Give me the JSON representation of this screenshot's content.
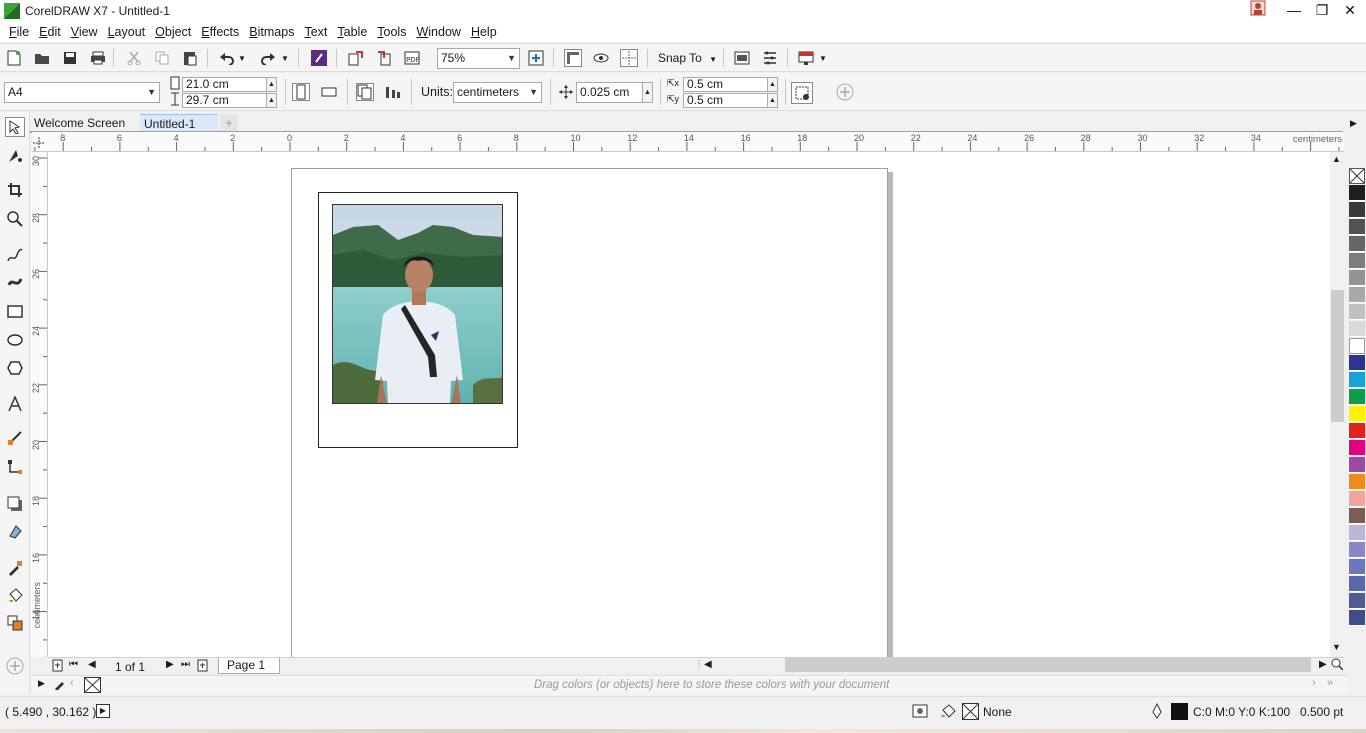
{
  "window": {
    "title": "CorelDRAW X7 - Untitled-1",
    "minimize": "—",
    "restore": "❐",
    "close": "✕"
  },
  "menu": [
    "File",
    "Edit",
    "View",
    "Layout",
    "Object",
    "Effects",
    "Bitmaps",
    "Text",
    "Table",
    "Tools",
    "Window",
    "Help"
  ],
  "toolbar": {
    "zoom_level": "75%",
    "snap_to_label": "Snap To"
  },
  "property_bar": {
    "page_size": "A4",
    "page_width": "21.0 cm",
    "page_height": "29.7 cm",
    "units_label": "Units:",
    "units_value": "centimeters",
    "nudge": "0.025 cm",
    "duplicate_x": "0.5 cm",
    "duplicate_y": "0.5 cm"
  },
  "tabs": [
    {
      "label": "Welcome Screen"
    },
    {
      "label": "Untitled-1",
      "active": true
    }
  ],
  "ruler": {
    "horizontal_ticks": [
      "8",
      "6",
      "4",
      "2",
      "0",
      "2",
      "4",
      "6",
      "8",
      "10",
      "12",
      "14",
      "16",
      "18",
      "20",
      "22",
      "24",
      "26",
      "28",
      "30",
      "32",
      "34"
    ],
    "unit_label": "centimeters",
    "vertical_ticks": [
      "30",
      "28",
      "26",
      "24",
      "22",
      "20",
      "18",
      "16",
      "14"
    ],
    "vertical_unit_label": "centimeters"
  },
  "page_nav": {
    "page_count": "1 of 1",
    "page_tab": "Page 1"
  },
  "doc_palette": {
    "hint": "Drag colors (or objects) here to store these colors with your document"
  },
  "status": {
    "coordinates": "( 5.490 , 30.162 )",
    "fill_label": "None",
    "outline_color": "C:0 M:0 Y:0 K:100",
    "outline_width": "0.500 pt"
  },
  "palette_colors": [
    "#1e1e1e",
    "#3a3a3a",
    "#525252",
    "#676767",
    "#7d7d7d",
    "#939393",
    "#a9a9a9",
    "#c0c0c0",
    "#d9d9d9",
    "#ffffff",
    "#2b3590",
    "#1aa0dc",
    "#0a9e4a",
    "#fff200",
    "#e32119",
    "#e4007c",
    "#9b4aa0",
    "#f08a1c",
    "#f6a39a",
    "#7a5f50",
    "#bab7dd",
    "#8b86c4",
    "#6b78bb",
    "#5b67a8",
    "#4f5a96",
    "#3f4e84"
  ],
  "colors": {
    "accent": "#3c8edc",
    "active_tab": "#d9e8fb"
  }
}
